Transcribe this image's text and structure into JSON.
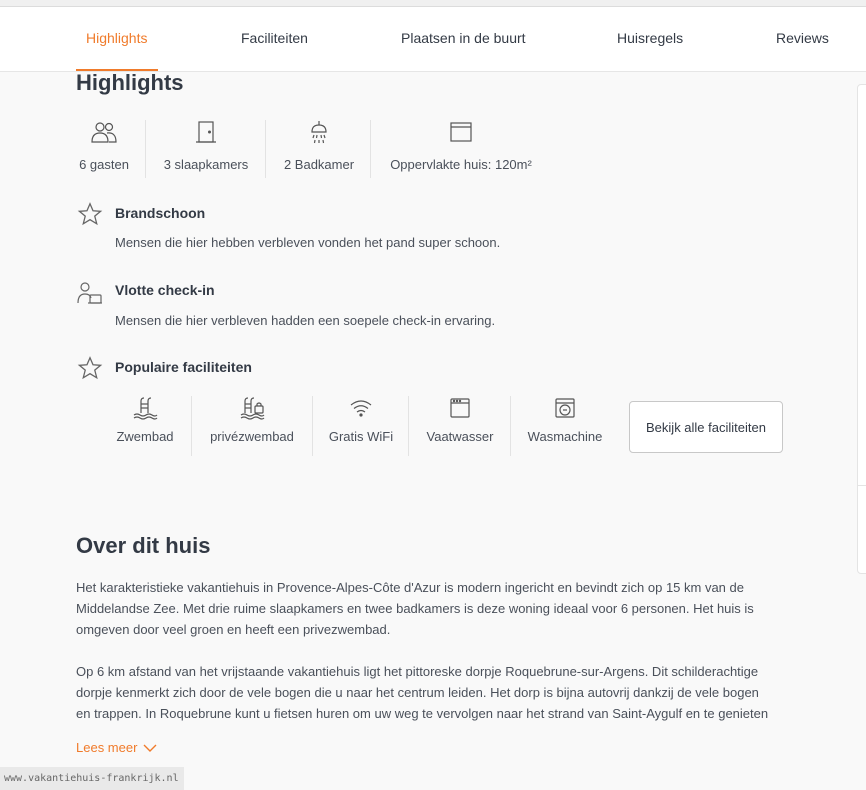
{
  "nav": {
    "tabs": [
      "Highlights",
      "Faciliteiten",
      "Plaatsen in de buurt",
      "Huisregels",
      "Reviews"
    ],
    "active_tab": "Highlights"
  },
  "highlights": {
    "title": "Highlights",
    "stats": [
      {
        "icon": "guests-icon",
        "label": "6 gasten"
      },
      {
        "icon": "door-icon",
        "label": "3 slaapkamers"
      },
      {
        "icon": "shower-icon",
        "label": "2 Badkamer"
      },
      {
        "icon": "area-icon",
        "label": "Oppervlakte huis: 120m²"
      }
    ],
    "items": [
      {
        "icon": "star-icon",
        "title": "Brandschoon",
        "description": "Mensen die hier hebben verbleven vonden het pand super schoon."
      },
      {
        "icon": "checkin-icon",
        "title": "Vlotte check-in",
        "description": "Mensen die hier verbleven hadden een soepele check-in ervaring."
      },
      {
        "icon": "star-icon",
        "title": "Populaire faciliteiten"
      }
    ],
    "facilities": [
      {
        "icon": "pool-icon",
        "label": "Zwembad"
      },
      {
        "icon": "private-pool-icon",
        "label": "privézwembad"
      },
      {
        "icon": "wifi-icon",
        "label": "Gratis WiFi"
      },
      {
        "icon": "dishwasher-icon",
        "label": "Vaatwasser"
      },
      {
        "icon": "washing-machine-icon",
        "label": "Wasmachine"
      }
    ],
    "all_facilities_button": "Bekijk alle faciliteiten"
  },
  "about": {
    "title": "Over dit huis",
    "paragraphs": [
      [
        "Het karakteristieke vakantiehuis in Provence-Alpes-Côte d'Azur is modern ingericht en bevindt zich op 15 km van de",
        "Middelandse Zee. Met drie ruime slaapkamers en twee badkamers is deze woning ideaal voor 6 personen. Het huis is",
        "omgeven door veel groen en heeft een privezwembad."
      ],
      [
        "Op 6 km afstand van het vrijstaande vakantiehuis ligt het pittoreske dorpje Roquebrune-sur-Argens. Dit schilderachtige",
        "dorpje kenmerkt zich door de vele bogen die u naar het centrum leiden. Het dorp is bijna autovrij dankzij de vele bogen",
        "en trappen. In Roquebrune kunt u fietsen huren om uw weg te vervolgen naar het strand van Saint-Aygulf en te genieten"
      ]
    ],
    "read_more": "Lees meer"
  },
  "watermark": "www.vakantiehuis-frankrijk.nl",
  "colors": {
    "accent": "#f07b2b",
    "text": "#333a45",
    "muted": "#4a505a",
    "background": "#f9f9f9"
  }
}
